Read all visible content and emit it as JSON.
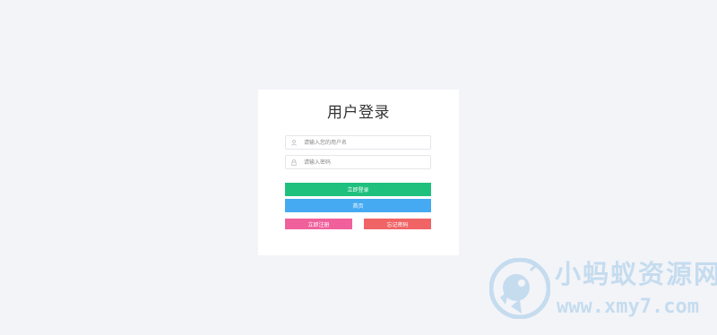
{
  "login": {
    "title": "用户登录",
    "username_placeholder": "请输入您的用户名",
    "password_placeholder": "请输入密码",
    "username_icon": "user-icon",
    "password_icon": "lock-icon",
    "buttons": {
      "login": "立即登录",
      "home": "首页",
      "register": "立即注册",
      "forgot": "忘记密码"
    }
  },
  "colors": {
    "login": "#1fc07e",
    "home": "#45aaf2",
    "register": "#f0609b",
    "forgot": "#f06466",
    "background": "#f3f4f8"
  },
  "watermark": {
    "name": "小蚂蚁资源网",
    "url": "www.xmy7.com",
    "icon": "ant-logo-icon"
  }
}
